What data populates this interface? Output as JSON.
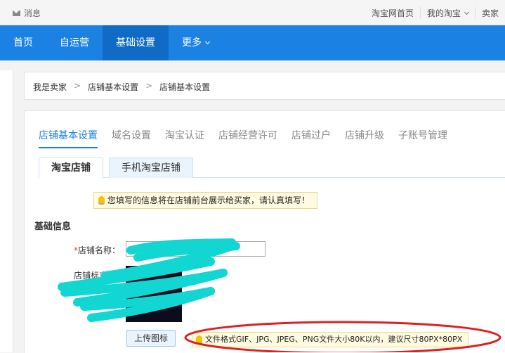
{
  "topbar": {
    "message_label": "消息",
    "links": [
      "淘宝网首页",
      "我的淘宝",
      "卖家"
    ]
  },
  "nav": {
    "items": [
      "首页",
      "自运营",
      "基础设置",
      "更多"
    ]
  },
  "breadcrumb": {
    "items": [
      "我是卖家",
      "店铺基本设置",
      "店铺基本设置"
    ],
    "separator": ">"
  },
  "tabs": [
    "店铺基本设置",
    "域名设置",
    "淘宝认证",
    "店铺经营许可",
    "店铺过户",
    "店铺升级",
    "子账号管理"
  ],
  "subtabs": [
    "淘宝店铺",
    "手机淘宝店铺"
  ],
  "notice": "您填写的信息将在店铺前台展示给买家，请认真填写！",
  "form": {
    "section_title": "基础信息",
    "required_mark": "*",
    "shop_name_label": "店铺名称：",
    "shop_logo_label": "店铺标志：",
    "upload_button": "上传图标",
    "upload_hint": "文件格式GIF、JPG、JPEG、PNG文件大小80K以内，建议尺寸80PX*80PX"
  },
  "colors": {
    "nav_bg": "#1b82e4",
    "nav_active": "#0f6bc6",
    "tab_active": "#1b82e4",
    "annotation_circle": "#e02020",
    "redaction_scribble": "#12d6d2"
  }
}
